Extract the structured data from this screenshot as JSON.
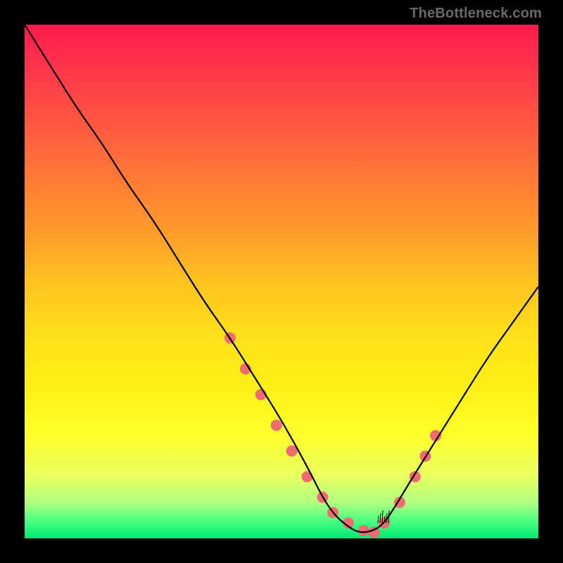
{
  "watermark": "TheBottleneck.com",
  "chart_data": {
    "type": "line",
    "title": "",
    "xlabel": "",
    "ylabel": "",
    "xlim": [
      0,
      100
    ],
    "ylim": [
      0,
      100
    ],
    "grid": false,
    "series": [
      {
        "name": "bottleneck-curve",
        "color": "#000000",
        "x": [
          0,
          5,
          10,
          15,
          20,
          25,
          30,
          35,
          40,
          45,
          50,
          55,
          58,
          60,
          62,
          65,
          68,
          70,
          72,
          75,
          80,
          85,
          90,
          95,
          100
        ],
        "values": [
          100,
          92,
          84,
          77,
          69,
          62,
          54,
          46,
          39,
          31,
          23,
          14,
          8,
          5,
          3,
          1,
          1.5,
          3,
          6,
          11,
          19,
          27,
          35,
          42,
          49
        ]
      }
    ],
    "markers": {
      "name": "highlighted-points",
      "color": "#ef6b72",
      "radius": 8,
      "x": [
        40,
        43,
        46,
        49,
        52,
        55,
        58,
        60,
        63,
        66,
        68,
        70,
        73,
        76,
        78,
        80
      ],
      "values": [
        39,
        33,
        28,
        22,
        17,
        12,
        8,
        5,
        3,
        1.5,
        1.2,
        3,
        7,
        12,
        16,
        20
      ]
    },
    "background_gradient": {
      "top_color": "#ff1a4d",
      "mid_color": "#ffdf1a",
      "bottom_color": "#00e874"
    }
  }
}
